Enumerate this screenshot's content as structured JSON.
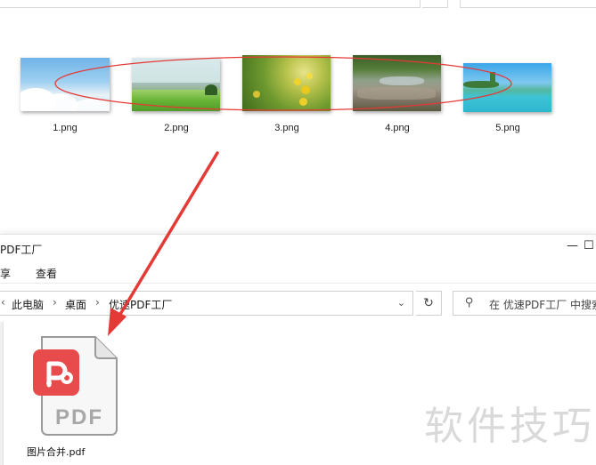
{
  "thumbnails": [
    {
      "name": "1.png"
    },
    {
      "name": "2.png"
    },
    {
      "name": "3.png"
    },
    {
      "name": "4.png"
    },
    {
      "name": "5.png"
    }
  ],
  "window": {
    "title": "PDF工厂",
    "ribbon": {
      "share": "享",
      "view": "查看"
    },
    "controls": {
      "minimize": "—",
      "maximize": "☐"
    },
    "address": {
      "back_glyph": "‹",
      "crumbs": [
        "此电脑",
        "桌面",
        "优速PDF工厂"
      ],
      "separator": "›",
      "dropdown": "⌄"
    },
    "refresh_glyph": "↻",
    "search": {
      "icon_glyph": "⚲",
      "placeholder": "在 优速PDF工厂 中搜索"
    }
  },
  "file": {
    "name": "图片合并.pdf",
    "badge": "PDF"
  },
  "watermark": "软件技巧",
  "colors": {
    "annotation_red": "#e53935",
    "pdf_red": "#e84b4b",
    "pdf_gray": "#9a9a9a"
  }
}
